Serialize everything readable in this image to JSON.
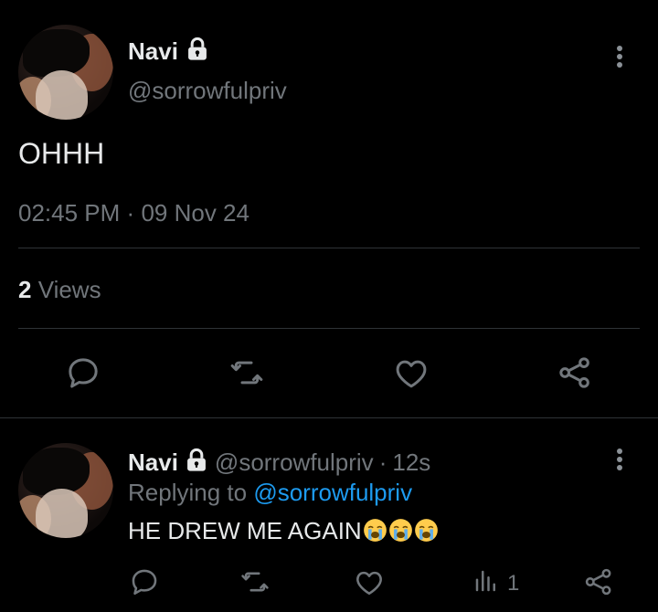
{
  "tweet": {
    "author_name": "Navi",
    "author_handle": "@sorrowfulpriv",
    "text": "OHHH",
    "time": "02:45 PM",
    "date_sep": "·",
    "date": "09 Nov 24",
    "views_count": "2",
    "views_label": "Views"
  },
  "reply": {
    "author_name": "Navi",
    "author_handle": "@sorrowfulpriv",
    "sep": "·",
    "age": "12s",
    "replying_to_label": "Replying to",
    "replying_to_handle": "@sorrowfulpriv",
    "text": "HE DREW ME AGAIN",
    "emojis": [
      "loudly-crying-face",
      "loudly-crying-face",
      "loudly-crying-face"
    ],
    "views_count": "1"
  },
  "icons": {
    "reply": "reply-icon",
    "retweet": "retweet-icon",
    "like": "heart-icon",
    "share": "share-icon",
    "views": "views-icon",
    "more": "more-options-icon",
    "lock": "lock-icon"
  },
  "colors": {
    "background": "#000000",
    "text": "#e7e9ea",
    "muted": "#71767b",
    "link": "#1d9bf0",
    "divider": "#2f3336"
  }
}
